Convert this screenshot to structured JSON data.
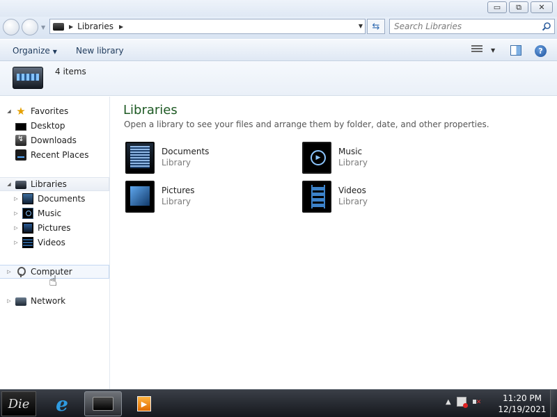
{
  "window": {
    "controls": {
      "minimize": "▭",
      "maximize": "⧉",
      "close": "✕"
    }
  },
  "address": {
    "path": [
      "Libraries"
    ],
    "refresh_icon": "refresh-icon",
    "search_placeholder": "Search Libraries"
  },
  "toolbar": {
    "organize_label": "Organize",
    "new_library_label": "New library",
    "help_label": "?"
  },
  "details": {
    "item_count": "4 items"
  },
  "nav": {
    "favorites": {
      "label": "Favorites",
      "items": [
        {
          "label": "Desktop",
          "icon": "desktop-icon"
        },
        {
          "label": "Downloads",
          "icon": "downloads-icon"
        },
        {
          "label": "Recent Places",
          "icon": "recent-places-icon"
        }
      ]
    },
    "libraries": {
      "label": "Libraries",
      "items": [
        {
          "label": "Documents",
          "icon": "documents-icon"
        },
        {
          "label": "Music",
          "icon": "music-icon"
        },
        {
          "label": "Pictures",
          "icon": "pictures-icon"
        },
        {
          "label": "Videos",
          "icon": "videos-icon"
        }
      ]
    },
    "computer": {
      "label": "Computer"
    },
    "network": {
      "label": "Network"
    }
  },
  "content": {
    "heading": "Libraries",
    "description": "Open a library to see your files and arrange them by folder, date, and other properties.",
    "items": [
      {
        "name": "Documents",
        "type": "Library",
        "icon": "documents-library-icon"
      },
      {
        "name": "Music",
        "type": "Library",
        "icon": "music-library-icon"
      },
      {
        "name": "Pictures",
        "type": "Library",
        "icon": "pictures-library-icon"
      },
      {
        "name": "Videos",
        "type": "Library",
        "icon": "videos-library-icon"
      }
    ]
  },
  "taskbar": {
    "start_label": "Die",
    "apps": [
      "internet-explorer-icon",
      "windows-explorer-icon",
      "media-player-icon"
    ],
    "tray": {
      "show_hidden": "▲",
      "time": "11:20 PM",
      "date": "12/19/2021"
    }
  },
  "colors": {
    "heading_green": "#1e5a24",
    "chrome_blue": "#dfe8f4",
    "taskbar": "#15181d"
  }
}
